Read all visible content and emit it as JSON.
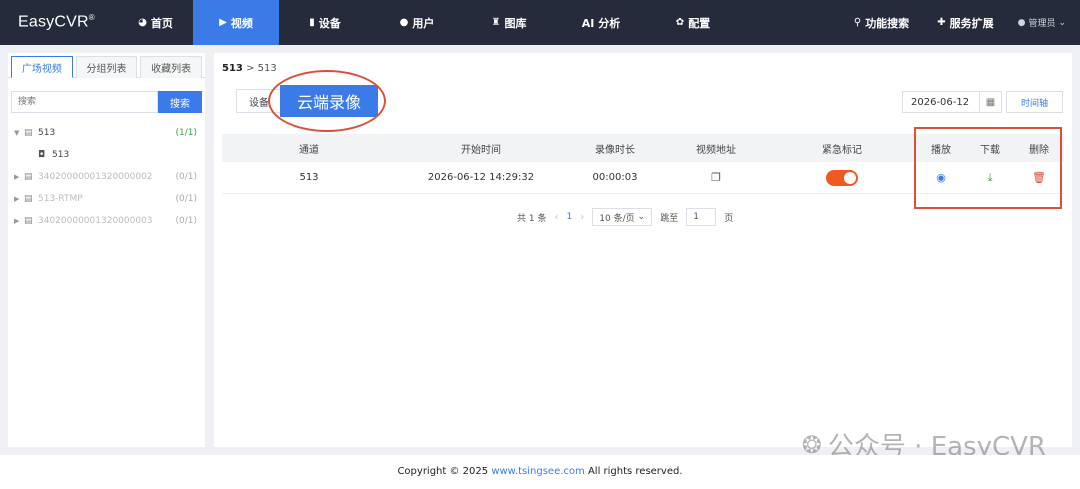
{
  "app": {
    "logo": "EasyCVR",
    "logo_mark": "®"
  },
  "nav": {
    "items": [
      {
        "label": "首页",
        "icon": "dashboard-icon"
      },
      {
        "label": "视频",
        "icon": "play-circle-icon"
      },
      {
        "label": "设备",
        "icon": "device-icon"
      },
      {
        "label": "用户",
        "icon": "user-icon"
      },
      {
        "label": "图库",
        "icon": "gallery-icon"
      },
      {
        "label": "AI 分析",
        "icon": ""
      },
      {
        "label": "配置",
        "icon": "gear-icon"
      }
    ],
    "right": [
      {
        "label": "功能搜索",
        "icon": "search-icon"
      },
      {
        "label": "服务扩展",
        "icon": "puzzle-icon"
      }
    ],
    "admin": "管理员"
  },
  "left": {
    "tabs": [
      "广场视频",
      "分组列表",
      "收藏列表"
    ],
    "search_placeholder": "搜索",
    "search_button": "搜索",
    "tree": [
      {
        "label": "513",
        "count": "(1/1)"
      },
      {
        "label": "513"
      },
      {
        "label": "34020000001320000002",
        "count": "(0/1)"
      },
      {
        "label": "513-RTMP",
        "count": "(0/1)"
      },
      {
        "label": "34020000001320000003",
        "count": "(0/1)"
      }
    ]
  },
  "main": {
    "breadcrumb_root": "513",
    "breadcrumb_sep": ">",
    "breadcrumb_leaf": "513",
    "tab_device": "设备",
    "tab_cloud": "云端录像",
    "date": "2026-06-12",
    "timeline_button": "时间轴",
    "table": {
      "headers": [
        "通道",
        "开始时间",
        "录像时长",
        "视频地址",
        "紧急标记",
        "播放",
        "下载",
        "删除"
      ],
      "rows": [
        {
          "channel": "513",
          "start": "2026-06-12 14:29:32",
          "duration": "00:00:03"
        }
      ]
    },
    "pager": {
      "total": "共 1 条",
      "page": "1",
      "page_size": "10 条/页",
      "jump_label": "跳至",
      "jump_value": "1",
      "page_unit": "页"
    }
  },
  "footer": {
    "prefix": "Copyright © 2025 ",
    "link": "www.tsingsee.com",
    "suffix": " All rights reserved."
  },
  "watermark": "公众号 · EasyCVR",
  "colors": {
    "nav_bg": "#252b3a",
    "accent": "#3a7be8",
    "toggle_on": "#f05a22",
    "annotation": "#d9513a"
  }
}
